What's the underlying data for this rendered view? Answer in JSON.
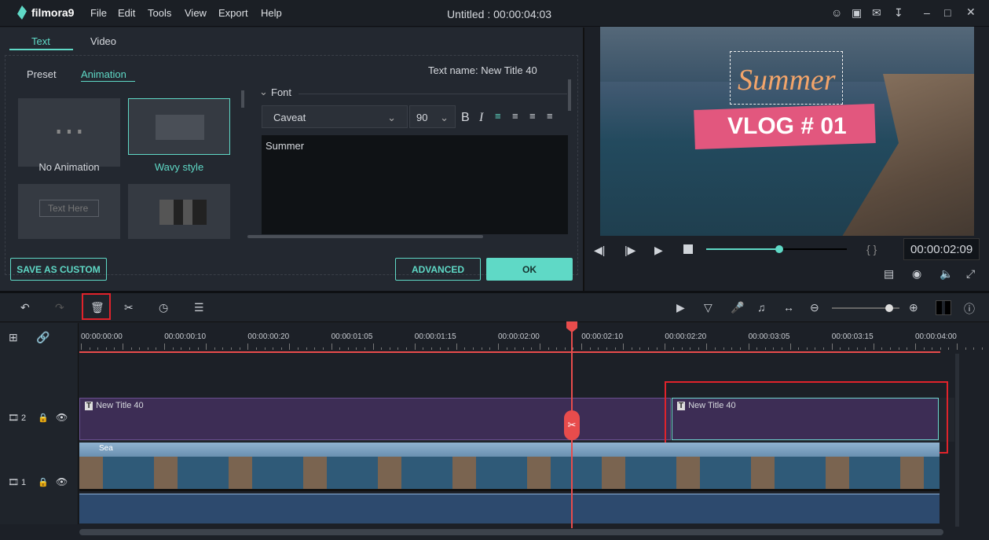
{
  "app": {
    "logo": "filmora9",
    "title": "Untitled : 00:00:04:03",
    "menu": [
      "File",
      "Edit",
      "Tools",
      "View",
      "Export",
      "Help"
    ]
  },
  "editor": {
    "tabs": [
      "Text",
      "Video"
    ],
    "subtabs": [
      "Preset",
      "Animation"
    ],
    "text_name": "Text name: New Title 40",
    "animations": [
      {
        "label": "No Animation"
      },
      {
        "label": "Wavy style",
        "selected": true
      },
      {
        "label": "Text Here"
      },
      {
        "label": ""
      }
    ],
    "font_section": "Font",
    "font": "Caveat",
    "size": "90",
    "bold": "B",
    "italic": "I",
    "text_value": "Summer",
    "save_custom": "SAVE AS CUSTOM",
    "advanced": "ADVANCED",
    "ok": "OK"
  },
  "preview": {
    "title_text": "Summer",
    "subtitle_text": "VLOG # 01",
    "timecode": "00:00:02:09",
    "progress_percent": 52,
    "brackets": "{ }"
  },
  "timeline": {
    "ruler": [
      "00:00:00:00",
      "00:00:00:10",
      "00:00:00:20",
      "00:00:01:05",
      "00:00:01:15",
      "00:00:02:00",
      "00:00:02:10",
      "00:00:02:20",
      "00:00:03:05",
      "00:00:03:15",
      "00:00:04:00"
    ],
    "tracks": [
      {
        "number": "2",
        "clips": [
          "New Title 40",
          "New Title 40"
        ]
      },
      {
        "number": "1",
        "clips": [
          "Sea"
        ]
      }
    ],
    "zoom_percent": 85
  },
  "colors": {
    "accent": "#5fd9c6",
    "playhead": "#e84c4c",
    "title_clip": "#3d2d55",
    "video_audio": "#2d4a6e",
    "highlight": "#e0232b"
  }
}
